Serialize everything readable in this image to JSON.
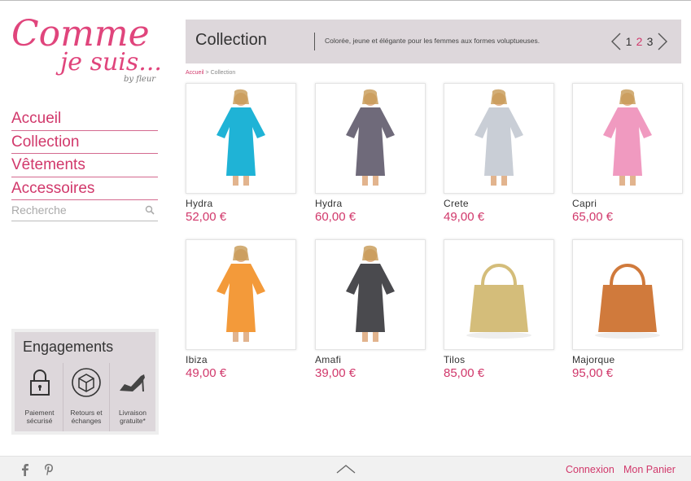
{
  "brand": {
    "logo_line1": "Comme",
    "logo_line2": "je suis...",
    "logo_sub": "by fleur"
  },
  "nav": [
    "Accueil",
    "Collection",
    "Vêtements",
    "Accessoires"
  ],
  "search": {
    "placeholder": "Recherche"
  },
  "engagements": {
    "title": "Engagements",
    "items": [
      {
        "label1": "Paiement",
        "label2": "sécurisé",
        "icon": "padlock-icon"
      },
      {
        "label1": "Retours et",
        "label2": "échanges",
        "icon": "box-icon"
      },
      {
        "label1": "Livraison",
        "label2": "gratuite*",
        "icon": "shoe-icon"
      }
    ]
  },
  "header": {
    "title": "Collection",
    "tagline": "Colorée, jeune et élégante pour les femmes aux formes voluptueuses.",
    "pages": [
      "1",
      "2",
      "3"
    ],
    "active_page": "2"
  },
  "breadcrumb": {
    "home": "Accueil",
    "sep": ">",
    "current": "Collection"
  },
  "products": [
    {
      "name": "Hydra",
      "price": "52,00 €",
      "color": "#1fb3d6"
    },
    {
      "name": "Hydra",
      "price": "60,00 €",
      "color": "#6f6a7a"
    },
    {
      "name": "Crete",
      "price": "49,00 €",
      "color": "#c9ced6"
    },
    {
      "name": "Capri",
      "price": "65,00 €",
      "color": "#f09ac0"
    },
    {
      "name": "Ibiza",
      "price": "49,00 €",
      "color": "#f39a3a"
    },
    {
      "name": "Amafi",
      "price": "39,00 €",
      "color": "#4a4a4e"
    },
    {
      "name": "Tilos",
      "price": "85,00 €",
      "color": "#d4bd7a"
    },
    {
      "name": "Majorque",
      "price": "95,00 €",
      "color": "#d07a3c"
    }
  ],
  "footer": {
    "login": "Connexion",
    "cart": "Mon Panier"
  },
  "colors": {
    "accent": "#d1386b",
    "panel": "#ddd7db"
  }
}
